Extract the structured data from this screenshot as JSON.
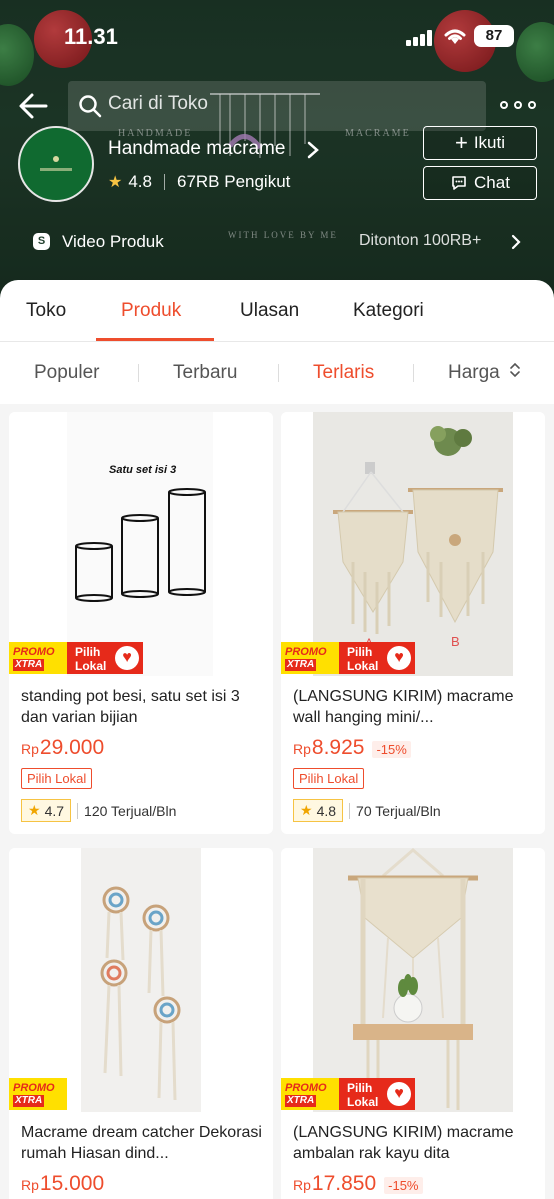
{
  "status_bar": {
    "time": "11.31",
    "battery": "87"
  },
  "header": {
    "search_placeholder": "Cari di Toko",
    "banner_text_left": "HANDMADE",
    "banner_text_right": "MACRAME",
    "banner_text_bottom": "WITH LOVE BY ME"
  },
  "shop": {
    "name": "Handmade macrame",
    "rating": "4.8",
    "followers": "67RB Pengikut",
    "follow_label": "Ikuti",
    "chat_label": "Chat",
    "video_label": "Video Produk",
    "video_views": "Ditonton 100RB+"
  },
  "tabs": [
    {
      "label": "Toko"
    },
    {
      "label": "Produk"
    },
    {
      "label": "Ulasan"
    },
    {
      "label": "Kategori"
    }
  ],
  "active_tab": "Produk",
  "sort": [
    {
      "label": "Populer"
    },
    {
      "label": "Terbaru"
    },
    {
      "label": "Terlaris"
    },
    {
      "label": "Harga"
    }
  ],
  "active_sort": "Terlaris",
  "badges": {
    "promo_line1": "PROMO",
    "promo_line2": "XTRA",
    "lokal_line1": "Pilih",
    "lokal_line2": "Lokal",
    "tag": "Pilih Lokal"
  },
  "products": [
    {
      "title": "standing pot besi, satu set isi 3 dan varian bijian",
      "currency": "Rp",
      "price": "29.000",
      "discount": "",
      "rating": "4.7",
      "sold": "120 Terjual/Bln",
      "image_caption": "Satu set isi 3"
    },
    {
      "title": "(LANGSUNG KIRIM) macrame wall hanging mini/...",
      "currency": "Rp",
      "price": "8.925",
      "discount": "-15%",
      "rating": "4.8",
      "sold": "70 Terjual/Bln",
      "image_label_a": "A",
      "image_label_b": "B"
    },
    {
      "title": "Macrame dream catcher Dekorasi rumah Hiasan dind...",
      "currency": "Rp",
      "price": "15.000",
      "discount": ""
    },
    {
      "title": "(LANGSUNG KIRIM) macrame ambalan rak kayu dita",
      "currency": "Rp",
      "price": "17.850",
      "discount": "-15%"
    }
  ],
  "colors": {
    "accent": "#ee4d2d",
    "banner": "#22402e"
  }
}
